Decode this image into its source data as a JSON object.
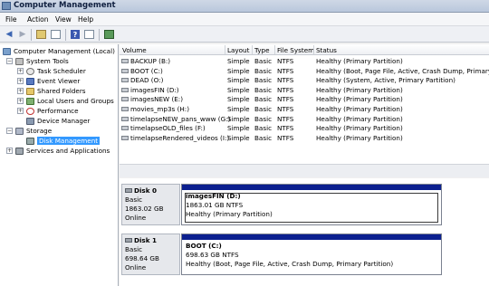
{
  "window": {
    "title": "Computer Management"
  },
  "menu": [
    "File",
    "Action",
    "View",
    "Help"
  ],
  "tree": {
    "items": [
      {
        "label": "Computer Management (Local)",
        "icon": "computer-icon",
        "level": 0,
        "expander": ""
      },
      {
        "label": "System Tools",
        "icon": "tools-icon",
        "level": 1,
        "expander": "−"
      },
      {
        "label": "Task Scheduler",
        "icon": "clock-icon",
        "level": 2,
        "expander": "+"
      },
      {
        "label": "Event Viewer",
        "icon": "event-viewer-icon",
        "level": 2,
        "expander": "+"
      },
      {
        "label": "Shared Folders",
        "icon": "folder-icon",
        "level": 2,
        "expander": "+"
      },
      {
        "label": "Local Users and Groups",
        "icon": "users-icon",
        "level": 2,
        "expander": "+"
      },
      {
        "label": "Performance",
        "icon": "performance-icon",
        "level": 2,
        "expander": "+"
      },
      {
        "label": "Device Manager",
        "icon": "device-manager-icon",
        "level": 2,
        "expander": ""
      },
      {
        "label": "Storage",
        "icon": "storage-icon",
        "level": 1,
        "expander": "−"
      },
      {
        "label": "Disk Management",
        "icon": "disk-icon",
        "level": 2,
        "expander": "",
        "selected": true
      },
      {
        "label": "Services and Applications",
        "icon": "services-icon",
        "level": 1,
        "expander": "+"
      }
    ]
  },
  "volume_list": {
    "columns": [
      "Volume",
      "Layout",
      "Type",
      "File System",
      "Status"
    ],
    "rows": [
      [
        "BACKUP (B:)",
        "Simple",
        "Basic",
        "NTFS",
        "Healthy (Primary Partition)"
      ],
      [
        "BOOT (C:)",
        "Simple",
        "Basic",
        "NTFS",
        "Healthy (Boot, Page File, Active, Crash Dump, Primary Pa"
      ],
      [
        "DEAD (O:)",
        "Simple",
        "Basic",
        "NTFS",
        "Healthy (System, Active, Primary Partition)"
      ],
      [
        "imagesFIN (D:)",
        "Simple",
        "Basic",
        "NTFS",
        "Healthy (Primary Partition)"
      ],
      [
        "imagesNEW (E:)",
        "Simple",
        "Basic",
        "NTFS",
        "Healthy (Primary Partition)"
      ],
      [
        "movies_mp3s (H:)",
        "Simple",
        "Basic",
        "NTFS",
        "Healthy (Primary Partition)"
      ],
      [
        "timelapseNEW_pans_www (G:)",
        "Simple",
        "Basic",
        "NTFS",
        "Healthy (Primary Partition)"
      ],
      [
        "timelapseOLD_files (F:)",
        "Simple",
        "Basic",
        "NTFS",
        "Healthy (Primary Partition)"
      ],
      [
        "timelapseRendered_videos (I:)",
        "Simple",
        "Basic",
        "NTFS",
        "Healthy (Primary Partition)"
      ]
    ]
  },
  "disks": [
    {
      "name": "Disk 0",
      "type": "Basic",
      "size": "1863.02 GB",
      "state": "Online",
      "partition": {
        "name": "imagesFIN  (D:)",
        "size": "1863.01 GB NTFS",
        "status": "Healthy (Primary Partition)"
      }
    },
    {
      "name": "Disk 1",
      "type": "Basic",
      "size": "698.64 GB",
      "state": "Online",
      "partition": {
        "name": "BOOT  (C:)",
        "size": "698.63 GB NTFS",
        "status": "Healthy (Boot, Page File, Active, Crash Dump, Primary Partition)"
      }
    }
  ],
  "colors": {
    "partition_band": "#0b1f8f",
    "selection": "#3399ff"
  }
}
